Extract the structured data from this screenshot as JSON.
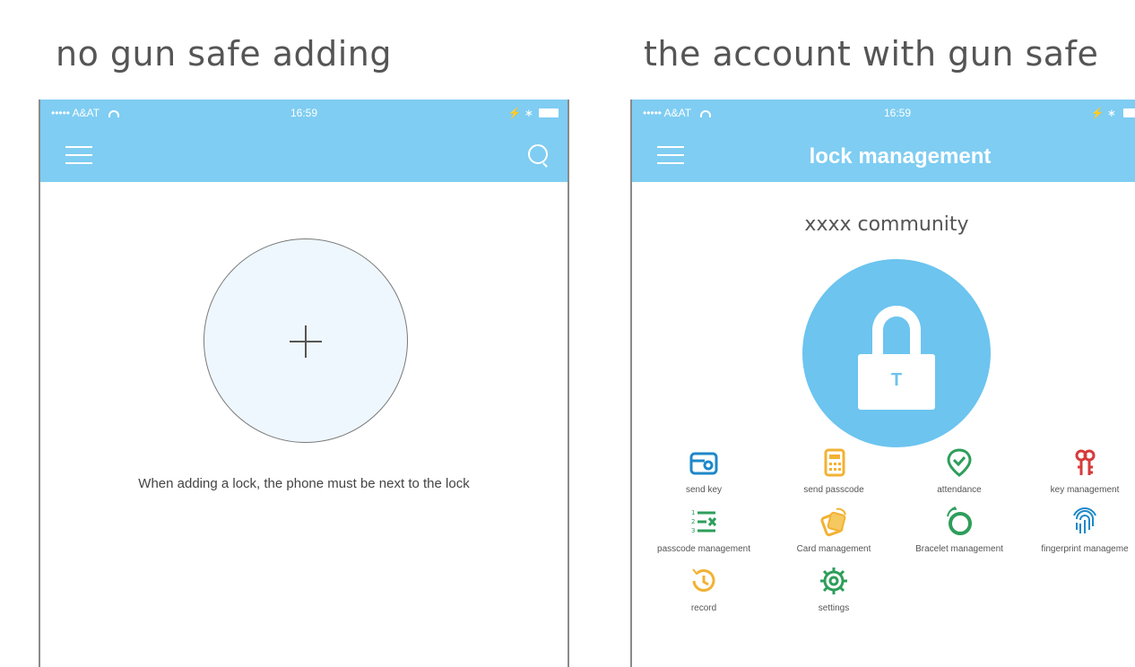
{
  "captions": {
    "left": "no gun safe adding",
    "right": "the account with gun safe"
  },
  "status_bar": {
    "carrier": "•••••  A&AT",
    "time": "16:59",
    "bluetooth": "⚡ ∗"
  },
  "left_screen": {
    "add_symbol": "+",
    "hint": "When adding a lock, the phone must be next to the lock"
  },
  "right_screen": {
    "title": "lock management",
    "community": "xxxx community",
    "lock_letter": "T",
    "features": [
      {
        "label": "send key",
        "icon": "key-card-icon",
        "color": "#1e88c9"
      },
      {
        "label": "send passcode",
        "icon": "calculator-icon",
        "color": "#f2b233"
      },
      {
        "label": "attendance",
        "icon": "check-location-icon",
        "color": "#2e9e5b"
      },
      {
        "label": "key management",
        "icon": "keys-icon",
        "color": "#d63b3b"
      },
      {
        "label": "passcode management",
        "icon": "numbered-list-icon",
        "color": "#2e9e5b"
      },
      {
        "label": "Card management",
        "icon": "cards-icon",
        "color": "#f2b233"
      },
      {
        "label": "Bracelet management",
        "icon": "bracelet-icon",
        "color": "#2e9e5b"
      },
      {
        "label": "fingerprint manageme",
        "icon": "fingerprint-icon",
        "color": "#1e88c9"
      },
      {
        "label": "record",
        "icon": "history-icon",
        "color": "#f2b233"
      },
      {
        "label": "settings",
        "icon": "gear-icon",
        "color": "#2e9e5b"
      }
    ]
  },
  "colors": {
    "header_blue": "#7fcdf2",
    "lock_blue": "#6cc4ef"
  }
}
